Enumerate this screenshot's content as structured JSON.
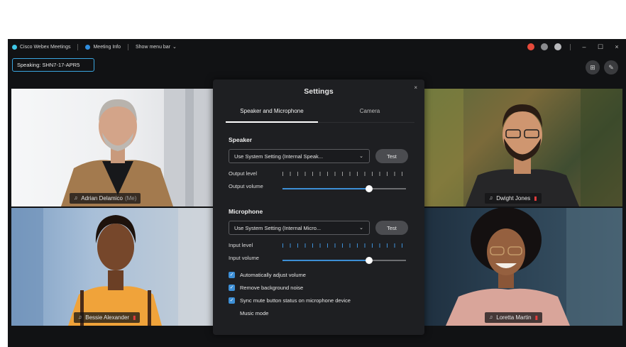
{
  "titlebar": {
    "app_name": "Cisco Webex Meetings",
    "meeting_info": "Meeting Info",
    "menu_bar": "Show menu bar",
    "minimize": "–",
    "maximize": "☐",
    "close": "×"
  },
  "speaking": "Speaking: SHN7-17-APR5",
  "participants": [
    {
      "name": "Adrian Delamico",
      "suffix": "(Me)"
    },
    {
      "name": "Dwight Jones"
    },
    {
      "name": "Bessie Alexander"
    },
    {
      "name": "Loretta Martin"
    }
  ],
  "settings": {
    "title": "Settings",
    "close": "×",
    "tabs": [
      "Speaker and Microphone",
      "Camera"
    ],
    "speaker": {
      "section": "Speaker",
      "device": "Use System Setting (Internal Speak...",
      "test": "Test",
      "level_label": "Output level",
      "volume_label": "Output volume",
      "volume": 0.7
    },
    "microphone": {
      "section": "Microphone",
      "device": "Use System Setting (Internal Micro...",
      "test": "Test",
      "level_label": "Input level",
      "volume_label": "Input volume",
      "volume": 0.7
    },
    "options": [
      {
        "label": "Automatically adjust volume",
        "checked": true
      },
      {
        "label": "Remove background noise",
        "checked": true
      },
      {
        "label": "Sync mute button status on microphone device",
        "checked": true
      },
      {
        "label": "Music mode",
        "checked": false
      }
    ]
  },
  "colors": {
    "accent": "#3d8fd6",
    "status_dot": "#e64a3b",
    "window_bg": "#111214"
  }
}
